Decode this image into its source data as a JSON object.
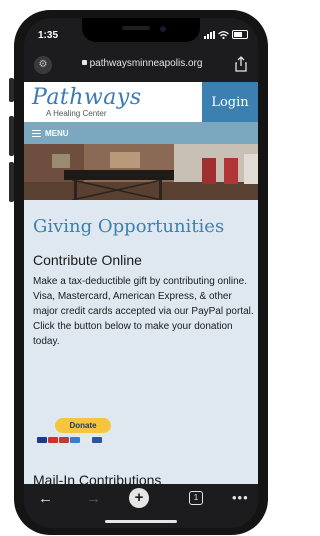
{
  "status_bar": {
    "time": "1:35"
  },
  "browser": {
    "url": "pathwaysminneapolis.org"
  },
  "site": {
    "logo": "Pathways",
    "tagline": "A Healing Center",
    "login_label": "Login",
    "menu_label": "MENU"
  },
  "content": {
    "heading": "Giving Opportunities",
    "section1_title": "Contribute Online",
    "section1_body": "Make a tax-deductible gift by contributing online.  Visa, Mastercard, American Express, & other major credit cards accepted via our PayPal portal. Click the button below to make your donation today.",
    "donate_label": "Donate",
    "section2_title": "Mail-In Contributions"
  },
  "toolbar": {
    "back_icon": "back-arrow-icon",
    "forward_icon": "forward-arrow-icon",
    "new_tab_icon": "plus-icon",
    "tabs_count": "1",
    "more_icon": "ellipsis-icon"
  },
  "colors": {
    "brand_blue": "#3b80b0",
    "menu_bar": "#7ba7bf",
    "content_bg": "#dfe8f1",
    "donate_yellow": "#f7c440"
  }
}
